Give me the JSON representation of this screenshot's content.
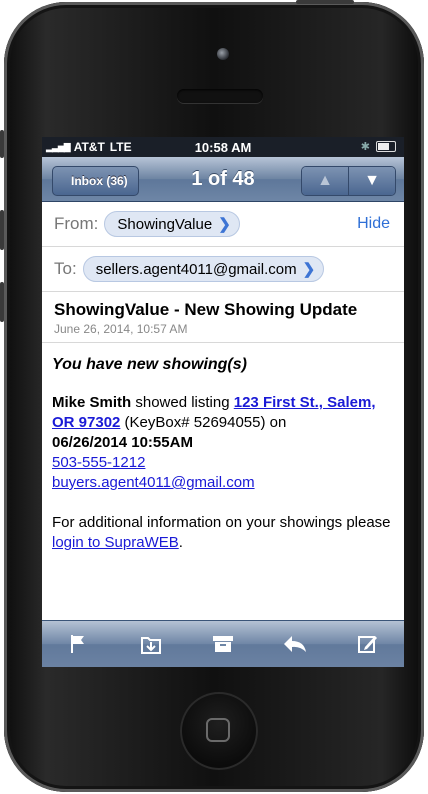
{
  "status": {
    "carrier": "AT&T",
    "network": "LTE",
    "time": "10:58 AM"
  },
  "nav": {
    "back_label": "Inbox (36)",
    "title": "1 of 48",
    "up_glyph": "▲",
    "down_glyph": "▼"
  },
  "header": {
    "from_label": "From:",
    "from_value": "ShowingValue",
    "to_label": "To:",
    "to_value": "sellers.agent4011@gmail.com",
    "hide_label": "Hide",
    "chevron": "❯"
  },
  "message": {
    "subject": "ShowingValue - New Showing Update",
    "date": "June 26, 2014, 10:57 AM",
    "intro": "You have new showing(s)",
    "agent_name": "Mike Smith",
    "showed_text": " showed listing ",
    "listing_link": "123 First St., Salem, OR 97302",
    "keybox_text": " (KeyBox# 52694055) on ",
    "showing_datetime": "06/26/2014 10:55AM",
    "phone": "503-555-1212",
    "agent_email": "buyers.agent4011@gmail.com",
    "footer_text": "For additional information on your showings please ",
    "login_link": "login to SupraWEB",
    "footer_end": "."
  },
  "toolbar": {
    "icons": [
      "flag-icon",
      "move-folder-icon",
      "archive-icon",
      "reply-icon",
      "compose-icon"
    ]
  },
  "colors": {
    "link": "#1a1ad6",
    "accent": "#2f6fd6",
    "bar_top": "#b7c4d7",
    "bar_bottom": "#5e779a"
  }
}
